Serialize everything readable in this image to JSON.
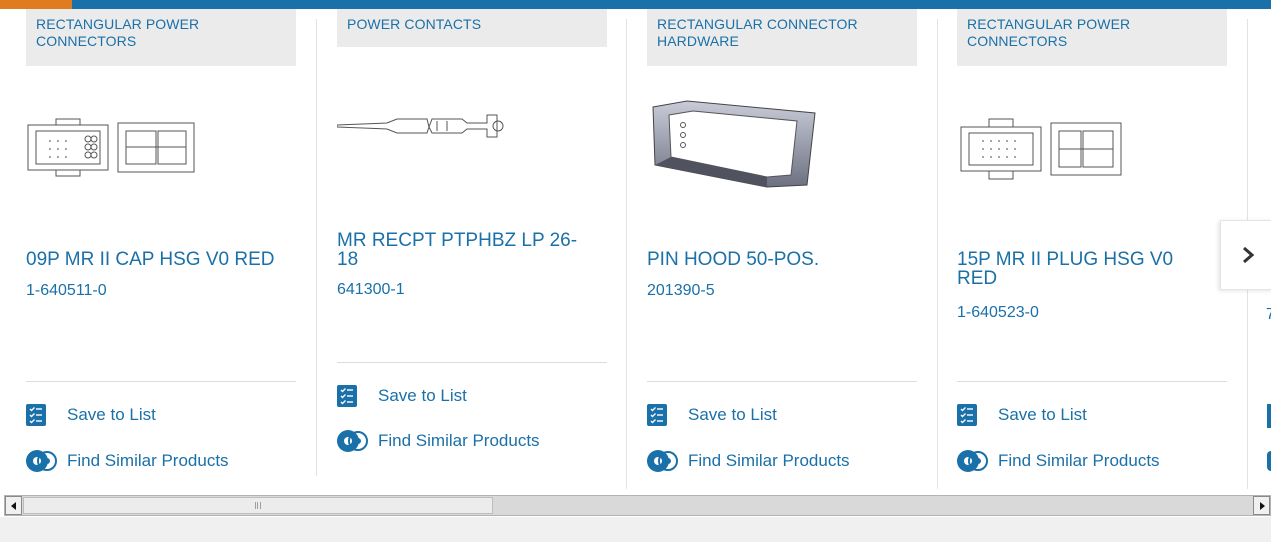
{
  "colors": {
    "brand_blue": "#1a70a8",
    "accent_orange": "#e07b1f",
    "category_bg": "#ebebeb"
  },
  "products": [
    {
      "category": "RECTANGULAR POWER CONNECTORS",
      "title": "09P MR II CAP HSG V0 RED",
      "part_number": "1-640511-0",
      "save_label": "Save to List",
      "similar_label": "Find Similar Products"
    },
    {
      "category": "POWER CONTACTS",
      "title": "MR RECPT PTPHBZ LP 26-18",
      "part_number": "641300-1",
      "save_label": "Save to List",
      "similar_label": "Find Similar Products"
    },
    {
      "category": "RECTANGULAR CONNECTOR HARDWARE",
      "title": "PIN HOOD 50-POS.",
      "part_number": "201390-5",
      "save_label": "Save to List",
      "similar_label": "Find Similar Products"
    },
    {
      "category": "RECTANGULAR POWER CONNECTORS",
      "title": "15P MR II PLUG HSG V0 RED",
      "part_number": "1-640523-0",
      "save_label": "Save to List",
      "similar_label": "Find Similar Products"
    }
  ],
  "next_card_peek": {
    "part_number_fragment": "7"
  },
  "icons": {
    "save": "save-to-list-icon",
    "similar": "find-similar-icon",
    "next": "chevron-right-icon"
  }
}
